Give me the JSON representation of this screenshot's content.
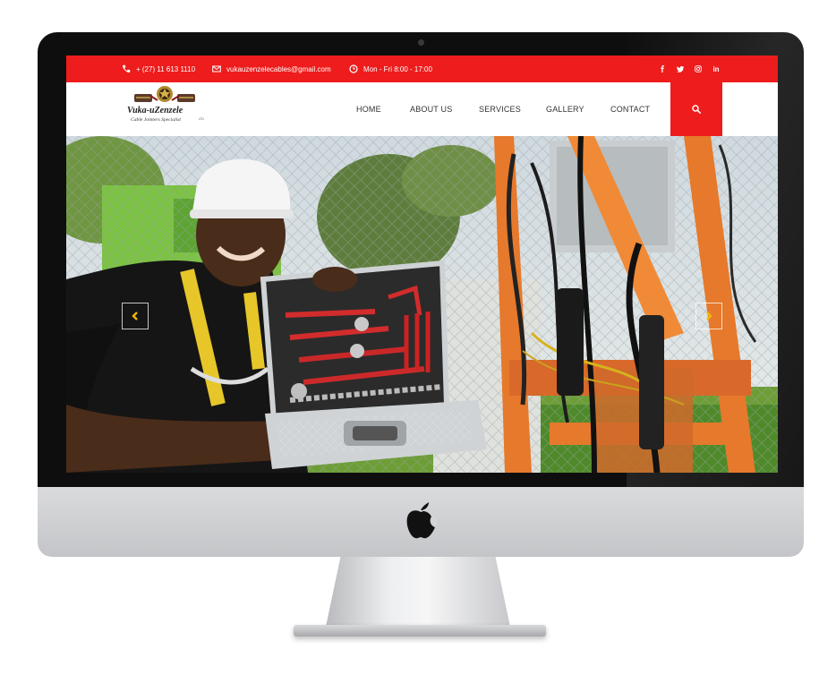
{
  "topbar": {
    "phone": "+ (27) 11 613 1110",
    "email": "vukauzenzelecables@gmail.com",
    "hours": "Mon - Fri 8:00 - 17:00",
    "social": [
      "f",
      "t",
      "i",
      "in"
    ],
    "social_icons": [
      "facebook-icon",
      "twitter-icon",
      "instagram-icon",
      "linkedin-icon"
    ],
    "color": "#ee1c1c"
  },
  "logo": {
    "name": "Vuka-uZenzele",
    "tagline": "Cable Jointers Specialist"
  },
  "nav": {
    "items": [
      "HOME",
      "ABOUT US",
      "SERVICES",
      "GALLERY",
      "CONTACT"
    ],
    "search_icon": "search-icon"
  },
  "hero": {
    "prev_icon": "chevron-left-icon",
    "next_icon": "chevron-right-icon",
    "arrow_color": "#f2b705"
  }
}
